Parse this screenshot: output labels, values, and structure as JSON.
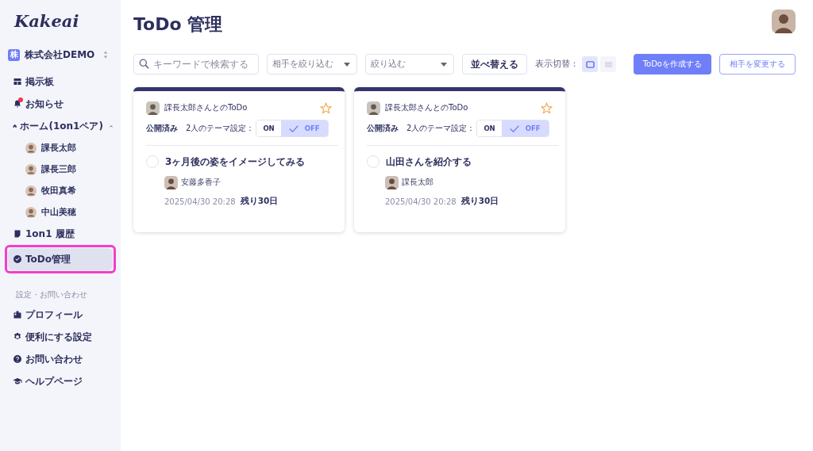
{
  "app": {
    "logo": "Kakeai"
  },
  "company": {
    "badge": "株",
    "name": "株式会社DEMO"
  },
  "sidebar": {
    "items": [
      {
        "kind": "nav",
        "label": "掲示板",
        "selected": false,
        "badge": false
      },
      {
        "kind": "nav",
        "label": "お知らせ",
        "selected": false,
        "badge": true
      },
      {
        "kind": "group",
        "label": "ホーム(1on1ペア)",
        "selected": false,
        "expanded": true,
        "children": [
          {
            "label": "課長太郎"
          },
          {
            "label": "課長三郎"
          },
          {
            "label": "牧田真希"
          },
          {
            "label": "中山美穂"
          }
        ]
      },
      {
        "kind": "nav",
        "label": "1on1 履歴",
        "selected": false,
        "badge": false
      },
      {
        "kind": "nav",
        "label": "ToDo管理",
        "selected": true,
        "badge": false,
        "highlight": true
      },
      {
        "kind": "heading",
        "label": "設定・お問い合わせ"
      },
      {
        "kind": "nav",
        "label": "プロフィール",
        "selected": false,
        "badge": false
      },
      {
        "kind": "nav",
        "label": "便利にする設定",
        "selected": false,
        "badge": false
      },
      {
        "kind": "nav",
        "label": "お問い合わせ",
        "selected": false,
        "badge": false
      },
      {
        "kind": "nav",
        "label": "ヘルプページ",
        "selected": false,
        "badge": false
      }
    ]
  },
  "page": {
    "title": "ToDo 管理"
  },
  "toolbar": {
    "search": {
      "placeholder": "キーワードで検索する"
    },
    "filters": [
      {
        "placeholder": "相手を絞り込む"
      },
      {
        "placeholder": "絞り込む"
      }
    ],
    "sort_button": "並べ替える",
    "view_label": "表示切替：",
    "views": [
      {
        "kind": "cards",
        "selected": true
      },
      {
        "kind": "list",
        "selected": false
      }
    ],
    "primary_button": "ToDoを作成する",
    "secondary_button": "相手を変更する"
  },
  "cards": [
    {
      "title": "課長太郎さんとのToDo",
      "starred": false,
      "status": "公開済み",
      "theme_label": "2人のテーマ設定：",
      "toggle": [
        {
          "label": "ON",
          "selected": false
        },
        {
          "label": "OFF",
          "selected": true
        }
      ],
      "task": "3ヶ月後の姿をイメージしてみる",
      "done": false,
      "assignee": "安藤多香子",
      "date": "2025/04/30 20:28",
      "remaining": "残り30日"
    },
    {
      "title": "課長太郎さんとのToDo",
      "starred": false,
      "status": "公開済み",
      "theme_label": "2人のテーマ設定：",
      "toggle": [
        {
          "label": "ON",
          "selected": false
        },
        {
          "label": "OFF",
          "selected": true
        }
      ],
      "task": "山田さんを紹介する",
      "done": false,
      "assignee": "課長太郎",
      "date": "2025/04/30 20:28",
      "remaining": "残り30日"
    }
  ]
}
